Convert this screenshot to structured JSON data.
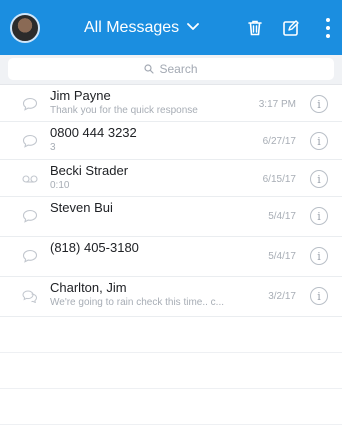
{
  "header": {
    "title": "All Messages",
    "accent_color": "#1b8ee0",
    "icons": [
      "avatar",
      "chevron-down-icon",
      "trash-icon",
      "compose-icon",
      "more-vertical-icon"
    ]
  },
  "search": {
    "placeholder": "Search"
  },
  "messages": [
    {
      "name": "Jim Payne",
      "preview": "Thank you for the quick response",
      "date": "3:17 PM",
      "type": "message"
    },
    {
      "name": "0800 444 3232",
      "preview": "3",
      "date": "6/27/17",
      "type": "message"
    },
    {
      "name": "Becki Strader",
      "preview": "0:10",
      "date": "6/15/17",
      "type": "voicemail"
    },
    {
      "name": "Steven Bui",
      "preview": "",
      "date": "5/4/17",
      "type": "message"
    },
    {
      "name": "(818) 405-3180",
      "preview": "",
      "date": "5/4/17",
      "type": "message"
    },
    {
      "name": "Charlton, Jim",
      "preview": "We're going to rain check this time.. c...",
      "date": "3/2/17",
      "type": "group-message"
    }
  ],
  "info_glyph": "i"
}
